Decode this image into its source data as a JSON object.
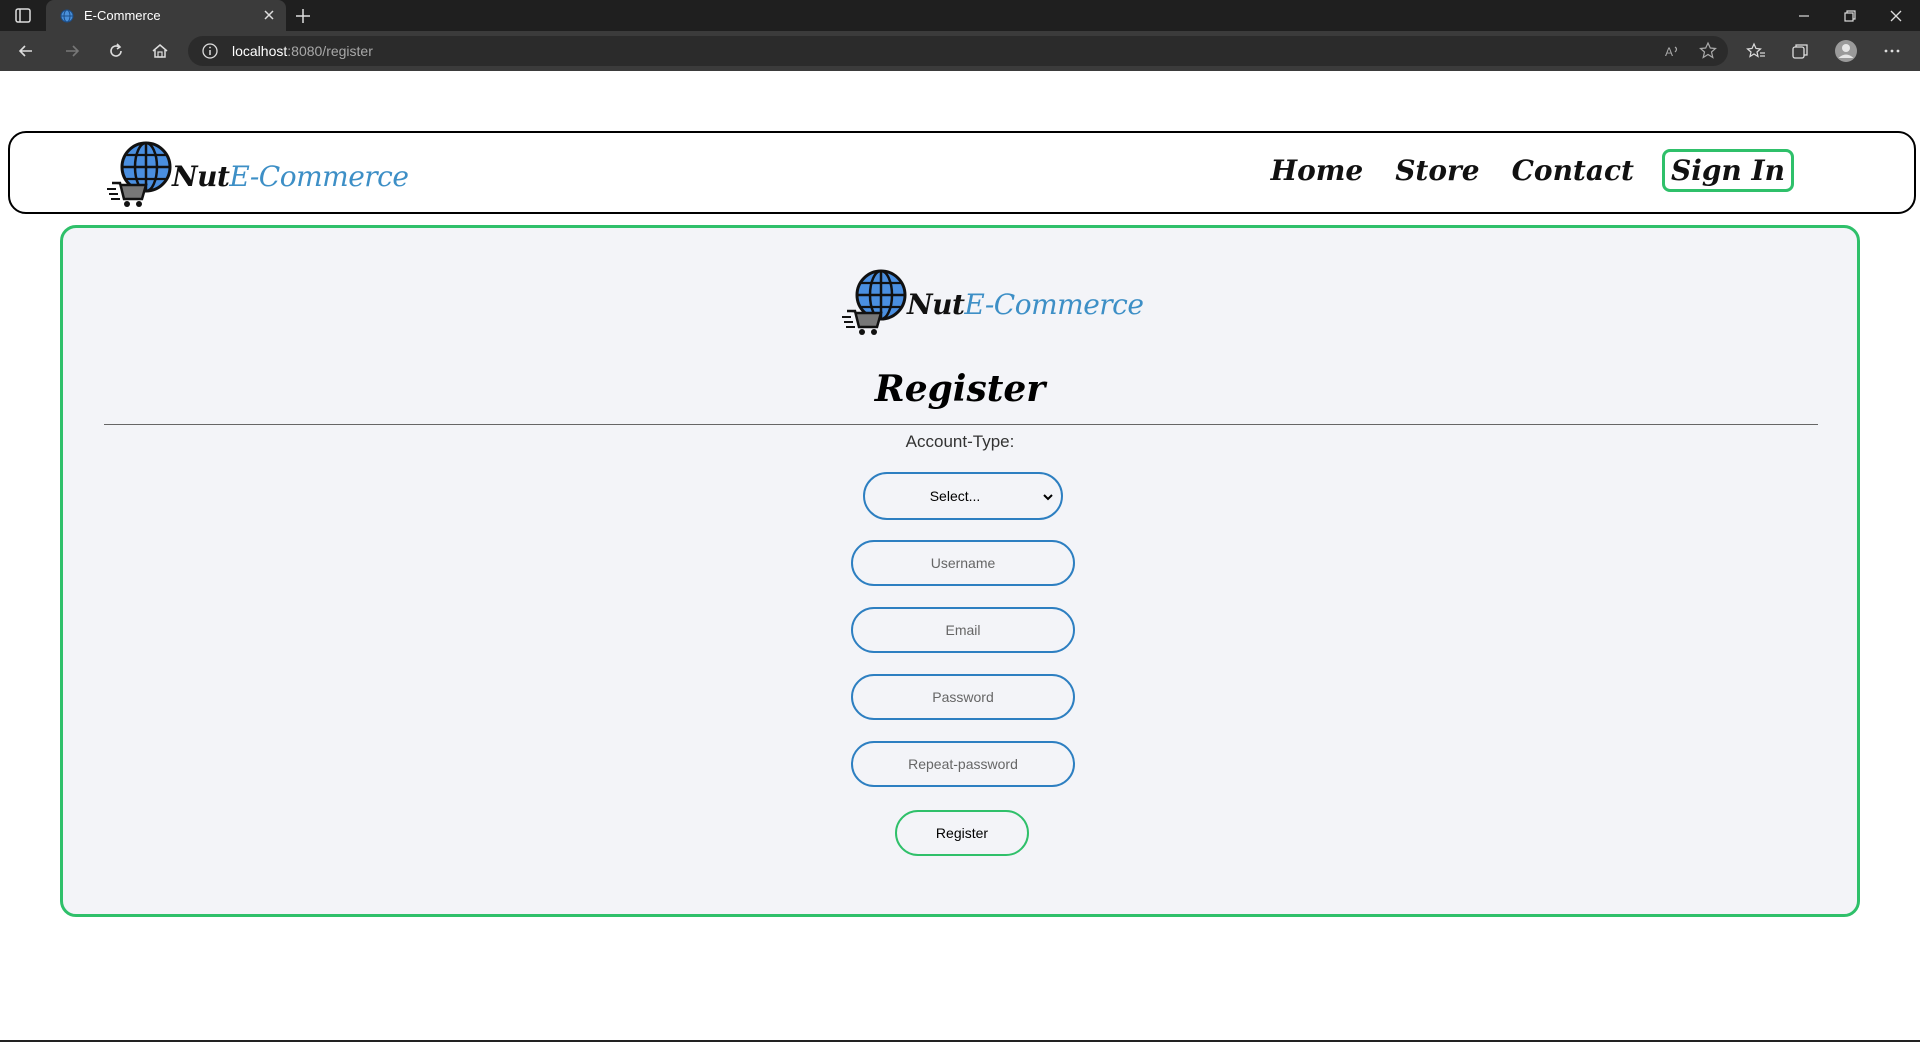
{
  "browser": {
    "tab_title": "E-Commerce",
    "url_host": "localhost",
    "url_path": ":8080/register"
  },
  "brand": {
    "name_part1": "Nut",
    "name_part2": "E-Commerce"
  },
  "nav": {
    "home": "Home",
    "store": "Store",
    "contact": "Contact",
    "signin": "Sign In"
  },
  "form": {
    "title": "Register",
    "account_type_label": "Account-Type:",
    "account_type_selected": "Select...",
    "username_placeholder": "Username",
    "email_placeholder": "Email",
    "password_placeholder": "Password",
    "repeat_password_placeholder": "Repeat-password",
    "submit_label": "Register"
  },
  "colors": {
    "accent_green": "#2fc06a",
    "input_blue": "#2d7fc1",
    "brand_blue": "#3d8fc6",
    "card_bg": "#f3f4f8"
  }
}
